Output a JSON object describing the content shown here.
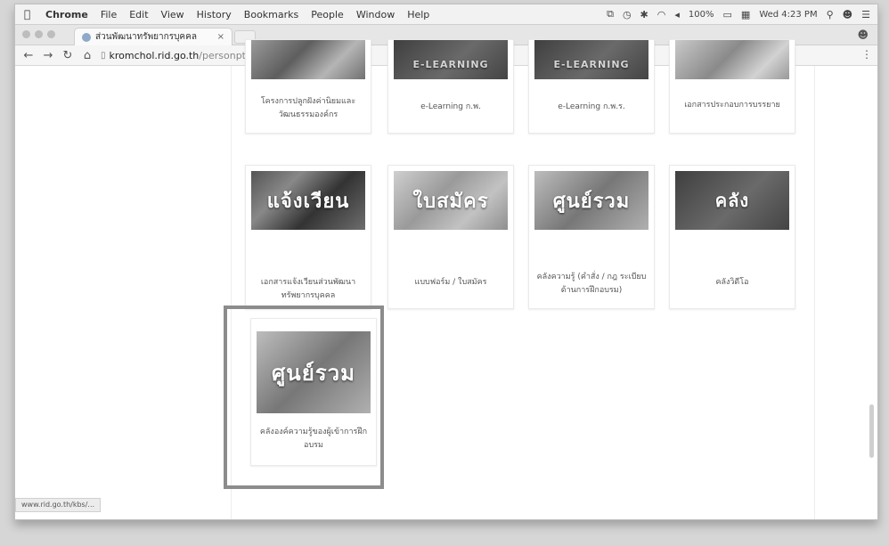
{
  "menubar": {
    "app": "Chrome",
    "items": [
      "File",
      "Edit",
      "View",
      "History",
      "Bookmarks",
      "People",
      "Window",
      "Help"
    ],
    "battery": "100%",
    "clock": "Wed 4:23 PM"
  },
  "tab": {
    "title": "ส่วนพัฒนาทรัพยากรบุคคล",
    "close": "×"
  },
  "address": {
    "host": "kromchol.rid.go.th",
    "path": "/personptrain"
  },
  "cards": [
    {
      "overlay": "",
      "label": "โครงการปลูกฝังค่านิยมและวัฒนธรรมองค์กร"
    },
    {
      "overlay": "E-LEARNING",
      "label": "e-Learning ก.พ."
    },
    {
      "overlay": "E-LEARNING",
      "label": "e-Learning ก.พ.ร."
    },
    {
      "overlay": "",
      "label": "เอกสารประกอบการบรรยาย"
    },
    {
      "overlay": "แจ้งเวียน",
      "label": "เอกสารแจ้งเวียนส่วนพัฒนาทรัพยากรบุคคล"
    },
    {
      "overlay": "ใบสมัคร",
      "label": "แบบฟอร์ม / ใบสมัคร"
    },
    {
      "overlay": "ศูนย์รวม",
      "label": "คลังความรู้ (คำสั่ง / กฎ ระเบียบด้านการฝึกอบรม)"
    },
    {
      "overlay": "คลัง",
      "label": "คลังวิดีโอ"
    },
    {
      "overlay": "ศูนย์รวม",
      "label": "คลังองค์ความรู้ของผู้เข้าการฝึกอบรม"
    }
  ],
  "status_url": "www.rid.go.th/kbs/...",
  "colors": {
    "highlight_border": "#8c8c8c",
    "page_bg": "#ffffff"
  }
}
